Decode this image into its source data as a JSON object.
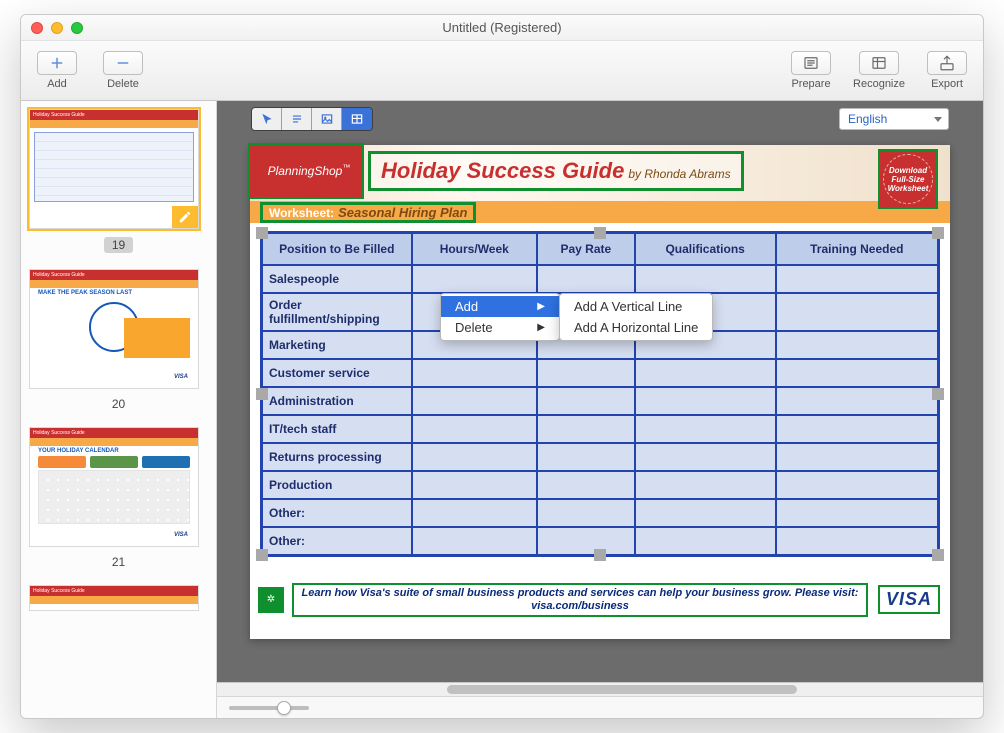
{
  "window": {
    "title": "Untitled (Registered)"
  },
  "toolbar": {
    "add": "Add",
    "delete": "Delete",
    "prepare": "Prepare",
    "recognize": "Recognize",
    "export": "Export"
  },
  "doc_toolbar": {
    "modes": [
      "pointer",
      "text",
      "image",
      "table"
    ],
    "active_mode": "table",
    "language": "English"
  },
  "sidebar": {
    "pages": [
      {
        "number": "19",
        "selected": true
      },
      {
        "number": "20",
        "selected": false
      },
      {
        "number": "21",
        "selected": false
      }
    ]
  },
  "page": {
    "brand": "PlanningShop",
    "title": "Holiday Success Guide",
    "byline": "by Rhonda Abrams",
    "download_chip": {
      "l1": "Download",
      "l2": "Full-Size",
      "l3": "Worksheet"
    },
    "worksheet_label": "Worksheet:",
    "worksheet_name": "Seasonal Hiring Plan",
    "footer_text": "Learn how Visa's suite of small business products and services can help your business grow. Please visit: visa.com/business",
    "visa": "VISA"
  },
  "table": {
    "headers": [
      "Position to Be Filled",
      "Hours/Week",
      "Pay Rate",
      "Qualifications",
      "Training Needed"
    ],
    "rows": [
      "Salespeople",
      "Order fulfillment/shipping",
      "Marketing",
      "Customer service",
      "Administration",
      "IT/tech staff",
      "Returns processing",
      "Production",
      "Other:",
      "Other:"
    ]
  },
  "context_menu": {
    "items": [
      "Add",
      "Delete"
    ],
    "selected": "Add",
    "submenu": [
      "Add A Vertical Line",
      "Add A Horizontal Line"
    ]
  }
}
